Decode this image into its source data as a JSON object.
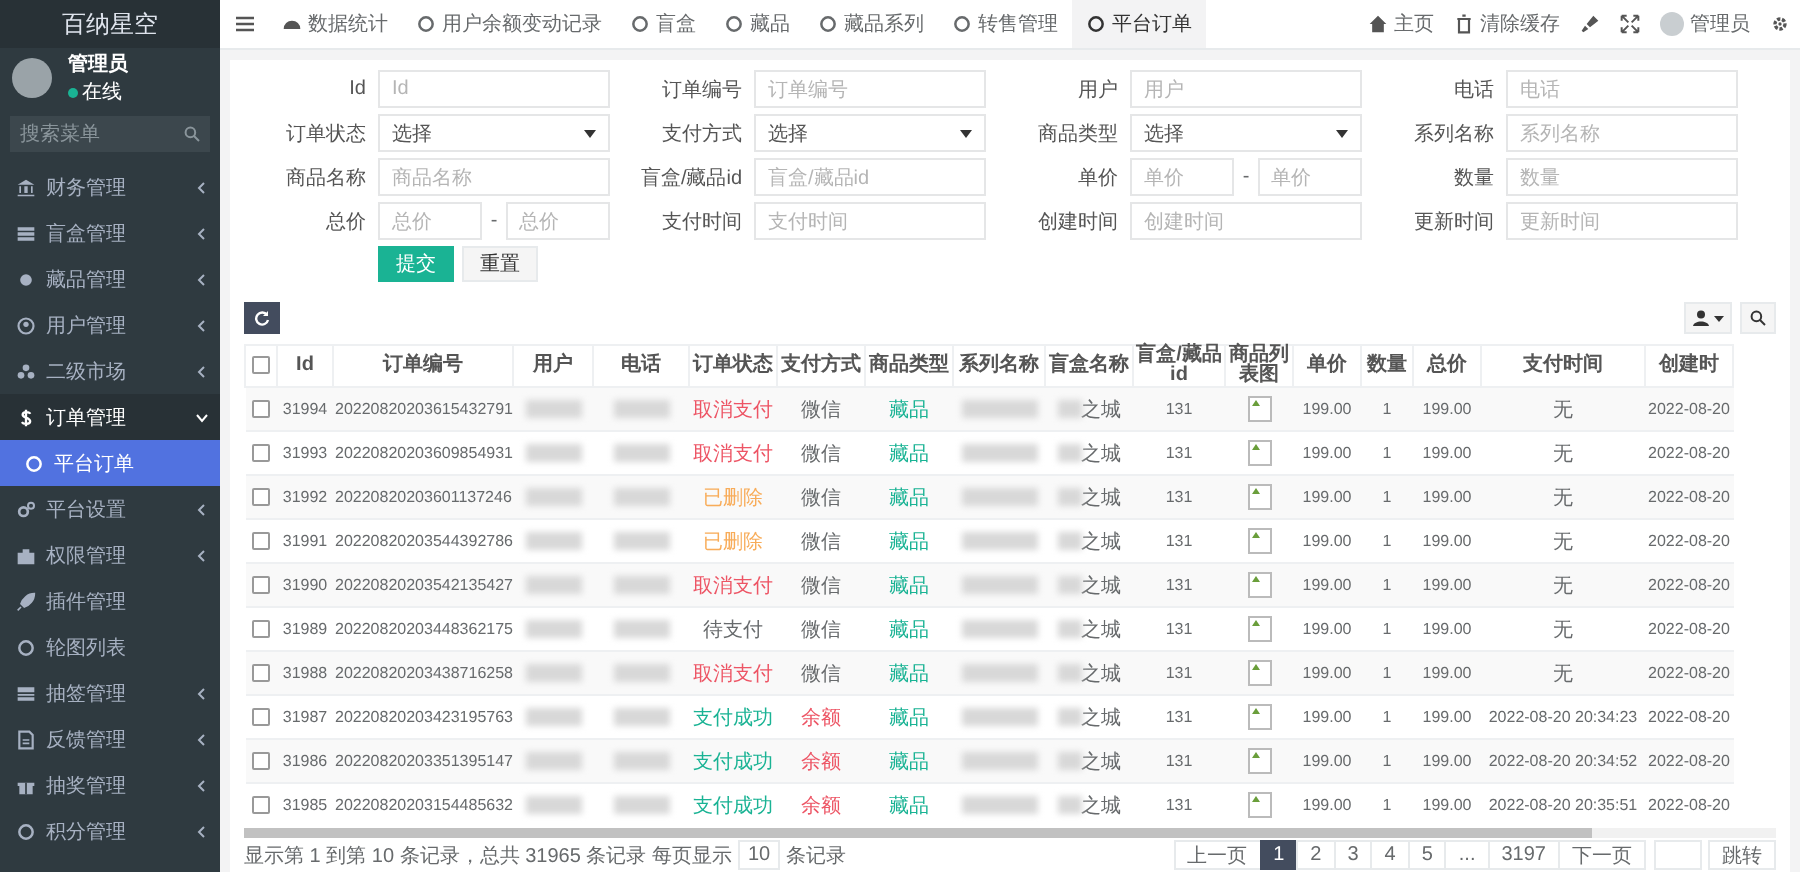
{
  "sidebar": {
    "brand": "百纳星空",
    "user": {
      "name": "管理员",
      "status": "在线",
      "online": true
    },
    "search": {
      "placeholder": "搜索菜单"
    },
    "items": [
      {
        "label": "财务管理",
        "kind": "group",
        "expanded": false
      },
      {
        "label": "盲盒管理",
        "kind": "group",
        "expanded": false
      },
      {
        "label": "藏品管理",
        "kind": "group",
        "expanded": false
      },
      {
        "label": "用户管理",
        "kind": "group",
        "expanded": false
      },
      {
        "label": "二级市场",
        "kind": "group",
        "expanded": false
      },
      {
        "label": "订单管理",
        "kind": "group",
        "expanded": true,
        "children": [
          {
            "label": "平台订单",
            "selected": true
          }
        ]
      },
      {
        "label": "平台设置",
        "kind": "group",
        "expanded": false
      },
      {
        "label": "权限管理",
        "kind": "group",
        "expanded": false
      },
      {
        "label": "插件管理",
        "kind": "link"
      },
      {
        "label": "轮图列表",
        "kind": "link"
      },
      {
        "label": "抽签管理",
        "kind": "group",
        "expanded": false
      },
      {
        "label": "反馈管理",
        "kind": "group",
        "expanded": false
      },
      {
        "label": "抽奖管理",
        "kind": "group",
        "expanded": false
      },
      {
        "label": "积分管理",
        "kind": "group",
        "expanded": false
      }
    ]
  },
  "topbar": {
    "tabs": [
      {
        "label": "数据统计",
        "selected": false
      },
      {
        "label": "用户余额变动记录",
        "selected": false
      },
      {
        "label": "盲盒",
        "selected": false
      },
      {
        "label": "藏品",
        "selected": false
      },
      {
        "label": "藏品系列",
        "selected": false
      },
      {
        "label": "转售管理",
        "selected": false
      },
      {
        "label": "平台订单",
        "selected": true
      }
    ],
    "home": "主页",
    "clear_cache": "清除缓存",
    "user": "管理员"
  },
  "filters": {
    "fields": [
      {
        "label": "Id",
        "kind": "text",
        "placeholder": "Id"
      },
      {
        "label": "订单编号",
        "kind": "text",
        "placeholder": "订单编号"
      },
      {
        "label": "用户",
        "kind": "text",
        "placeholder": "用户"
      },
      {
        "label": "电话",
        "kind": "text",
        "placeholder": "电话"
      },
      {
        "label": "订单状态",
        "kind": "select",
        "value": "选择"
      },
      {
        "label": "支付方式",
        "kind": "select",
        "value": "选择"
      },
      {
        "label": "商品类型",
        "kind": "select",
        "value": "选择"
      },
      {
        "label": "系列名称",
        "kind": "text",
        "placeholder": "系列名称"
      },
      {
        "label": "商品名称",
        "kind": "text",
        "placeholder": "商品名称"
      },
      {
        "label": "盲盒/藏品id",
        "kind": "text",
        "placeholder": "盲盒/藏品id"
      },
      {
        "label": "单价",
        "kind": "range",
        "placeholders": [
          "单价",
          "单价"
        ],
        "separator": "-"
      },
      {
        "label": "数量",
        "kind": "text",
        "placeholder": "数量"
      },
      {
        "label": "总价",
        "kind": "range",
        "placeholders": [
          "总价",
          "总价"
        ],
        "separator": "-"
      },
      {
        "label": "支付时间",
        "kind": "text",
        "placeholder": "支付时间"
      },
      {
        "label": "创建时间",
        "kind": "text",
        "placeholder": "创建时间"
      },
      {
        "label": "更新时间",
        "kind": "text",
        "placeholder": "更新时间"
      }
    ],
    "submit": "提交",
    "reset": "重置"
  },
  "table": {
    "select_all_checked": false,
    "columns": [
      "Id",
      "订单编号",
      "用户",
      "电话",
      "订单状态",
      "支付方式",
      "商品类型",
      "系列名称",
      "盲盒名称",
      "盲盒/藏品id",
      "商品列表图",
      "单价",
      "数量",
      "总价",
      "支付时间",
      "创建时"
    ],
    "rows": [
      {
        "checked": false,
        "id": "31994",
        "order_no": "20220820203615432791",
        "status": {
          "text": "取消支付",
          "color": "#ed5565"
        },
        "pay_method": {
          "text": "微信",
          "color": "#676a6c"
        },
        "type": {
          "text": "藏品",
          "color": "#1ab394"
        },
        "box_name": "之城",
        "box_id": "131",
        "price": "199.00",
        "qty": "1",
        "total": "199.00",
        "pay_time": "无",
        "created": "2022-08-20"
      },
      {
        "checked": false,
        "id": "31993",
        "order_no": "20220820203609854931",
        "status": {
          "text": "取消支付",
          "color": "#ed5565"
        },
        "pay_method": {
          "text": "微信",
          "color": "#676a6c"
        },
        "type": {
          "text": "藏品",
          "color": "#1ab394"
        },
        "box_name": "之城",
        "box_id": "131",
        "price": "199.00",
        "qty": "1",
        "total": "199.00",
        "pay_time": "无",
        "created": "2022-08-20"
      },
      {
        "checked": false,
        "id": "31992",
        "order_no": "20220820203601137246",
        "status": {
          "text": "已删除",
          "color": "#f8ac59"
        },
        "pay_method": {
          "text": "微信",
          "color": "#676a6c"
        },
        "type": {
          "text": "藏品",
          "color": "#1ab394"
        },
        "box_name": "之城",
        "box_id": "131",
        "price": "199.00",
        "qty": "1",
        "total": "199.00",
        "pay_time": "无",
        "created": "2022-08-20"
      },
      {
        "checked": false,
        "id": "31991",
        "order_no": "20220820203544392786",
        "status": {
          "text": "已删除",
          "color": "#f8ac59"
        },
        "pay_method": {
          "text": "微信",
          "color": "#676a6c"
        },
        "type": {
          "text": "藏品",
          "color": "#1ab394"
        },
        "box_name": "之城",
        "box_id": "131",
        "price": "199.00",
        "qty": "1",
        "total": "199.00",
        "pay_time": "无",
        "created": "2022-08-20"
      },
      {
        "checked": false,
        "id": "31990",
        "order_no": "20220820203542135427",
        "status": {
          "text": "取消支付",
          "color": "#ed5565"
        },
        "pay_method": {
          "text": "微信",
          "color": "#676a6c"
        },
        "type": {
          "text": "藏品",
          "color": "#1ab394"
        },
        "box_name": "之城",
        "box_id": "131",
        "price": "199.00",
        "qty": "1",
        "total": "199.00",
        "pay_time": "无",
        "created": "2022-08-20"
      },
      {
        "checked": false,
        "id": "31989",
        "order_no": "20220820203448362175",
        "status": {
          "text": "待支付",
          "color": "#676a6c"
        },
        "pay_method": {
          "text": "微信",
          "color": "#676a6c"
        },
        "type": {
          "text": "藏品",
          "color": "#1ab394"
        },
        "box_name": "之城",
        "box_id": "131",
        "price": "199.00",
        "qty": "1",
        "total": "199.00",
        "pay_time": "无",
        "created": "2022-08-20"
      },
      {
        "checked": false,
        "id": "31988",
        "order_no": "20220820203438716258",
        "status": {
          "text": "取消支付",
          "color": "#ed5565"
        },
        "pay_method": {
          "text": "微信",
          "color": "#676a6c"
        },
        "type": {
          "text": "藏品",
          "color": "#1ab394"
        },
        "box_name": "之城",
        "box_id": "131",
        "price": "199.00",
        "qty": "1",
        "total": "199.00",
        "pay_time": "无",
        "created": "2022-08-20"
      },
      {
        "checked": false,
        "id": "31987",
        "order_no": "20220820203423195763",
        "status": {
          "text": "支付成功",
          "color": "#1ab394"
        },
        "pay_method": {
          "text": "余额",
          "color": "#ed5565"
        },
        "type": {
          "text": "藏品",
          "color": "#1ab394"
        },
        "box_name": "之城",
        "box_id": "131",
        "price": "199.00",
        "qty": "1",
        "total": "199.00",
        "pay_time": "2022-08-20 20:34:23",
        "created": "2022-08-20"
      },
      {
        "checked": false,
        "id": "31986",
        "order_no": "20220820203351395147",
        "status": {
          "text": "支付成功",
          "color": "#1ab394"
        },
        "pay_method": {
          "text": "余额",
          "color": "#ed5565"
        },
        "type": {
          "text": "藏品",
          "color": "#1ab394"
        },
        "box_name": "之城",
        "box_id": "131",
        "price": "199.00",
        "qty": "1",
        "total": "199.00",
        "pay_time": "2022-08-20 20:34:52",
        "created": "2022-08-20"
      },
      {
        "checked": false,
        "id": "31985",
        "order_no": "20220820203154485632",
        "status": {
          "text": "支付成功",
          "color": "#1ab394"
        },
        "pay_method": {
          "text": "余额",
          "color": "#ed5565"
        },
        "type": {
          "text": "藏品",
          "color": "#1ab394"
        },
        "box_name": "之城",
        "box_id": "131",
        "price": "199.00",
        "qty": "1",
        "total": "199.00",
        "pay_time": "2022-08-20 20:35:51",
        "created": "2022-08-20"
      }
    ]
  },
  "footer": {
    "summary_before": "显示第 1 到第 10 条记录，总共 31965 条记录 每页显示",
    "page_size": "10",
    "summary_after": "条记录",
    "pages": [
      {
        "label": "上一页",
        "selected": false
      },
      {
        "label": "1",
        "selected": true
      },
      {
        "label": "2",
        "selected": false
      },
      {
        "label": "3",
        "selected": false
      },
      {
        "label": "4",
        "selected": false
      },
      {
        "label": "5",
        "selected": false
      },
      {
        "label": "...",
        "selected": false
      },
      {
        "label": "3197",
        "selected": false
      },
      {
        "label": "下一页",
        "selected": false
      }
    ],
    "jump": "跳转"
  }
}
